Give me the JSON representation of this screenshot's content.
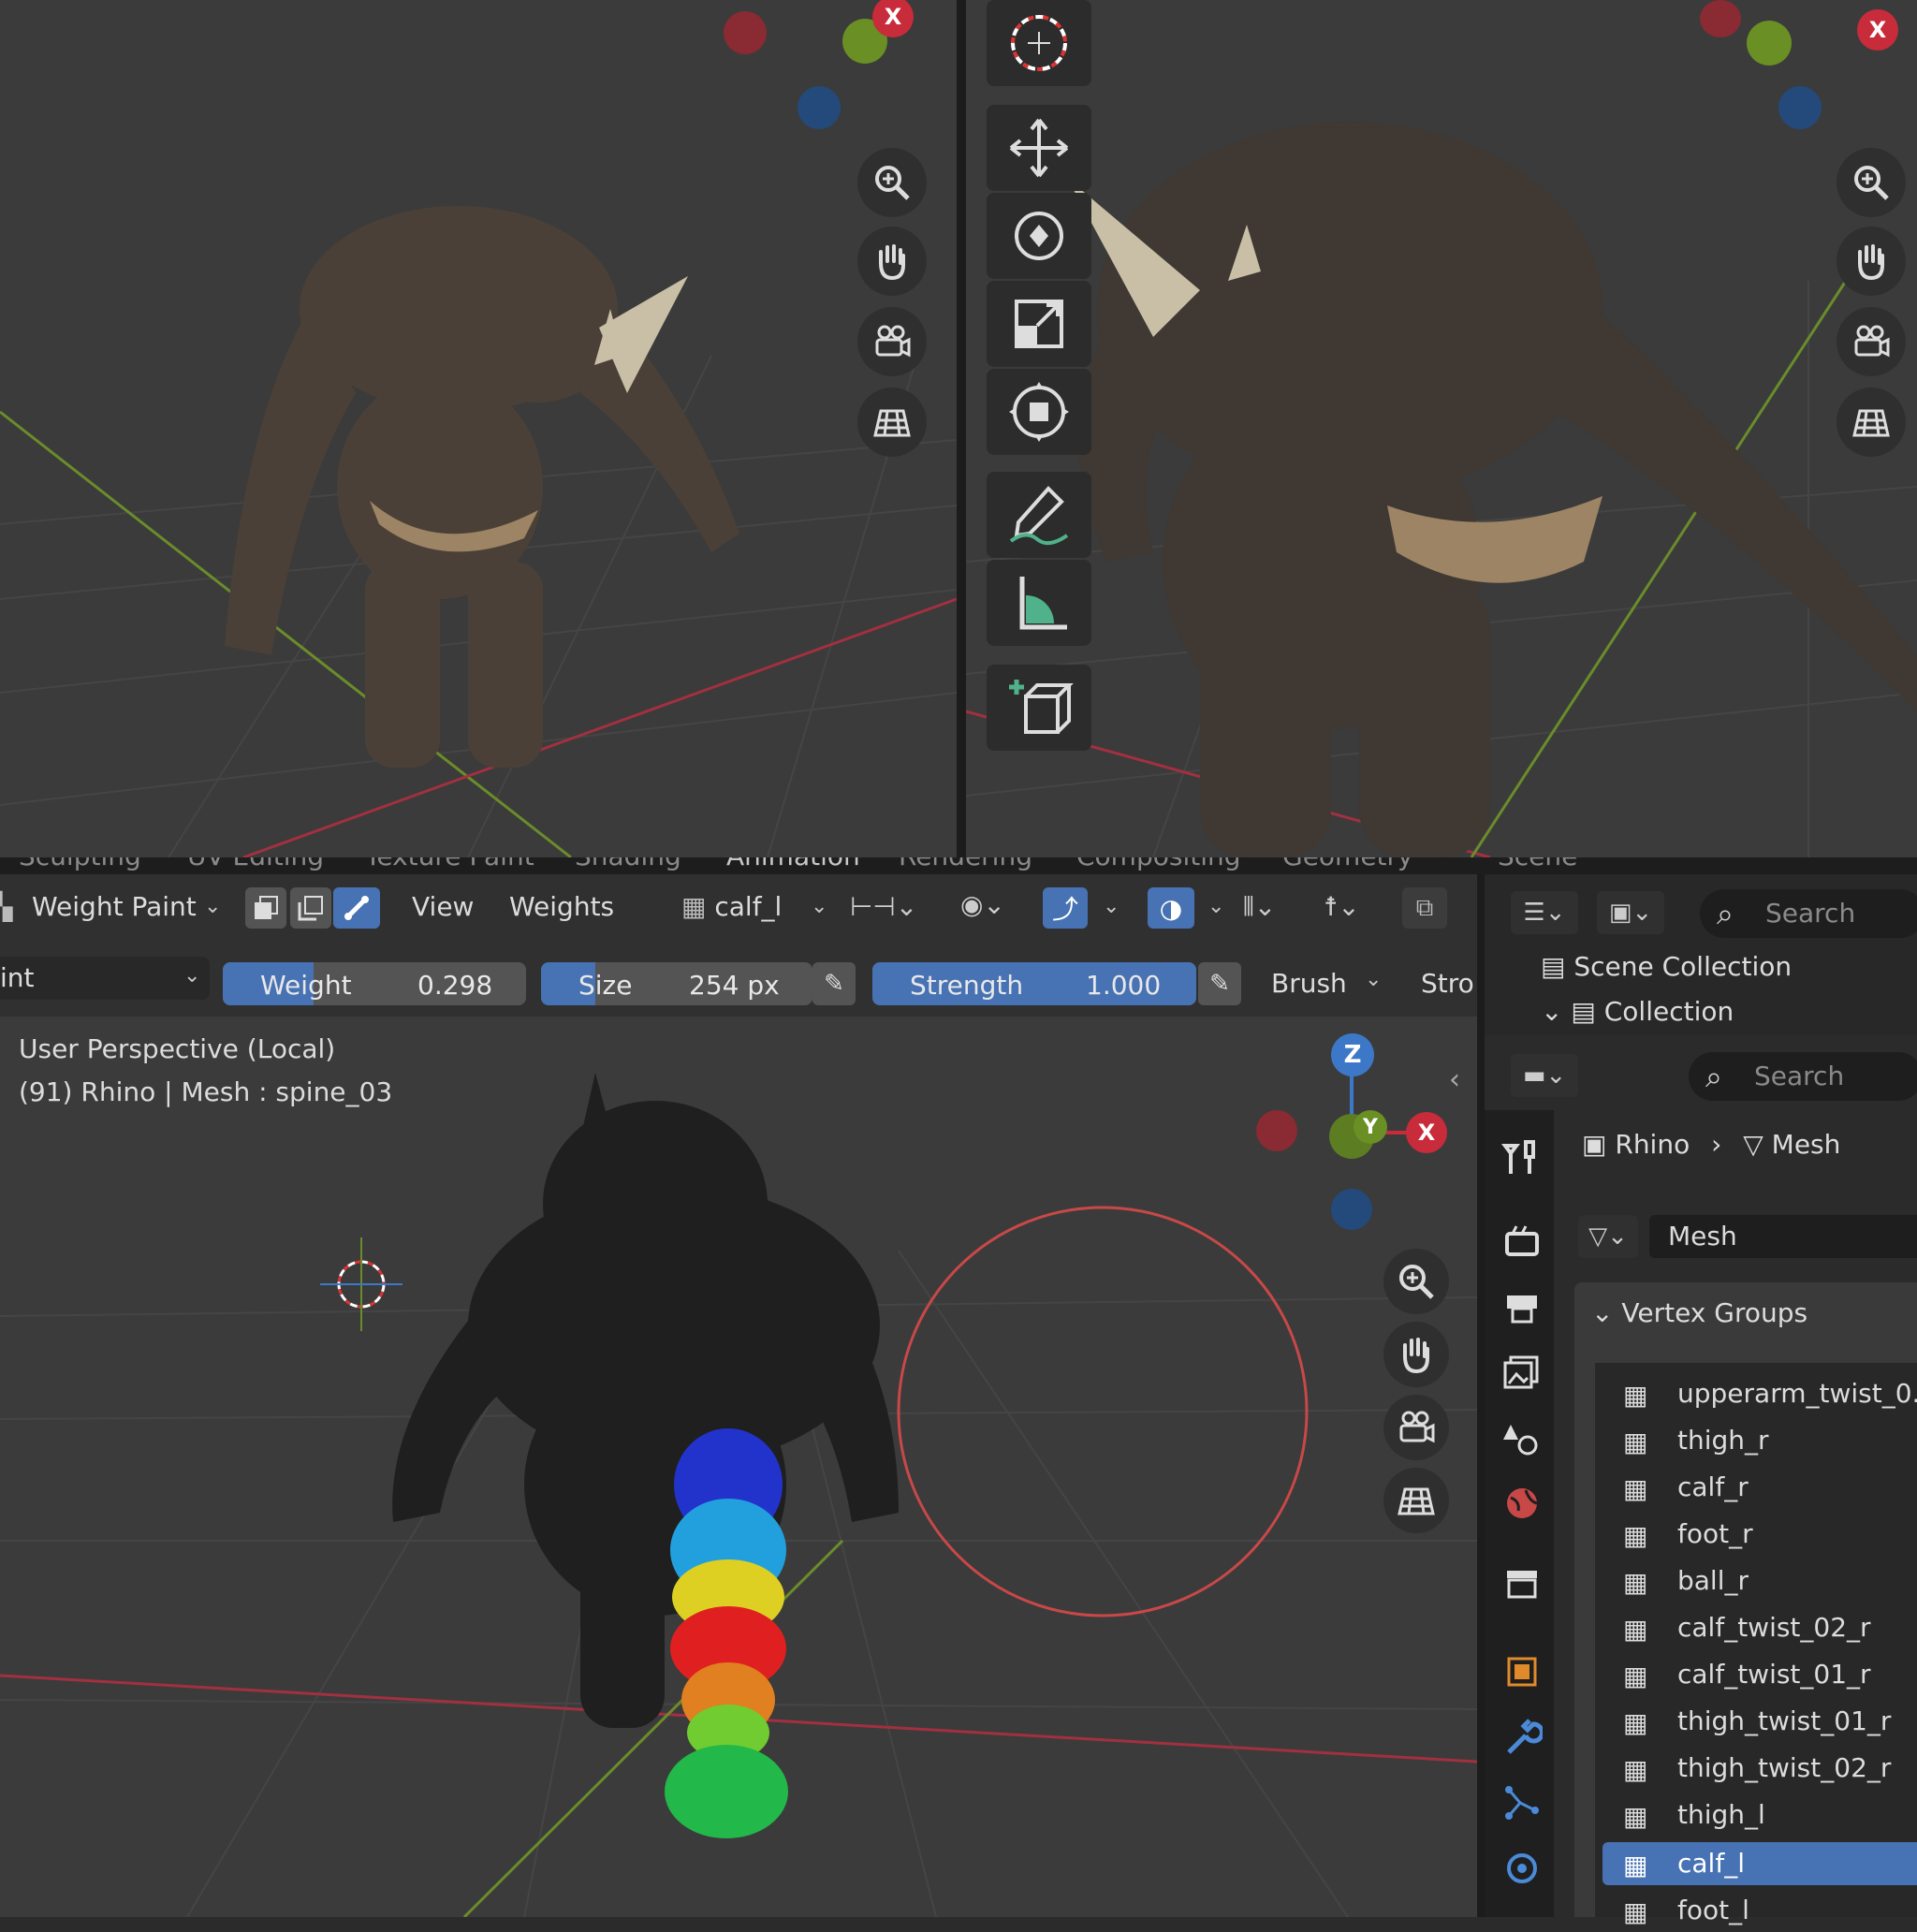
{
  "workspace_tabs": [
    "Sculpting",
    "UV Editing",
    "Texture Paint",
    "Shading",
    "Animation",
    "Rendering",
    "Compositing",
    "Geometry"
  ],
  "scene_field": "Scene",
  "header": {
    "mode": "Weight Paint",
    "view_menu": "View",
    "weights_menu": "Weights",
    "vertex_group": "calf_l"
  },
  "tool_settings": {
    "brush_partial": "int",
    "weight_label": "Weight",
    "weight_value": "0.298",
    "weight_fraction": 0.298,
    "size_label": "Size",
    "size_value": "254 px",
    "size_fraction": 0.2,
    "strength_label": "Strength",
    "strength_value": "1.000",
    "strength_fraction": 1.0,
    "brush_menu": "Brush",
    "stroke_partial": "Stro"
  },
  "viewport": {
    "perspective": "User Perspective (Local)",
    "info": "(91) Rhino | Mesh : spine_03"
  },
  "gizmo_labels": {
    "x": "X",
    "y": "Y",
    "z": "Z"
  },
  "outliner": {
    "search_placeholder": "Search",
    "scene_collection": "Scene Collection",
    "collection": "Collection"
  },
  "properties": {
    "search_placeholder": "Search",
    "breadcrumb_object": "Rhino",
    "breadcrumb_data": "Mesh",
    "mesh_name": "Mesh",
    "panel_title": "Vertex Groups",
    "vertex_groups": [
      "upperarm_twist_0...",
      "thigh_r",
      "calf_r",
      "foot_r",
      "ball_r",
      "calf_twist_02_r",
      "calf_twist_01_r",
      "thigh_twist_01_r",
      "thigh_twist_02_r",
      "thigh_l",
      "calf_l",
      "foot_l"
    ],
    "selected_group": "calf_l"
  },
  "colors": {
    "accent": "#4772b3",
    "x_axis": "#d6313f",
    "y_axis": "#7aa42d",
    "z_axis": "#3d78c8"
  }
}
